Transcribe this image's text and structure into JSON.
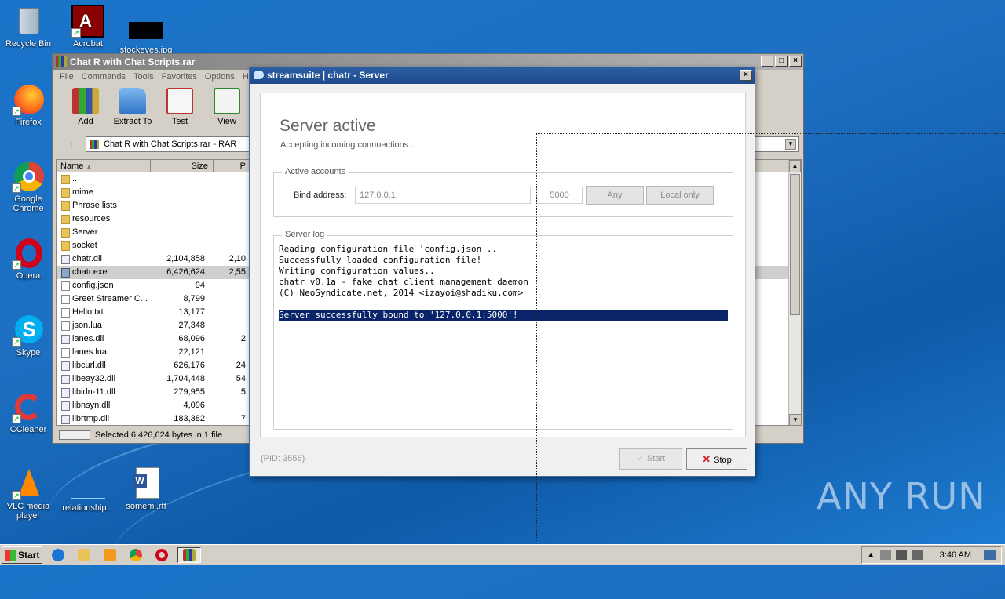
{
  "desktop": {
    "icons": [
      {
        "label": "Recycle Bin"
      },
      {
        "label": "Acrobat"
      },
      {
        "label": "stockeyes.jpg"
      },
      {
        "label": "Firefox"
      },
      {
        "label": "Google Chrome"
      },
      {
        "label": "Opera"
      },
      {
        "label": "Skype"
      },
      {
        "label": "CCleaner"
      },
      {
        "label": "VLC media player"
      },
      {
        "label": "relationship..."
      },
      {
        "label": "somemi.rtf"
      }
    ],
    "watermark": "ANY RUN"
  },
  "winrar": {
    "title": "Chat R with Chat Scripts.rar",
    "menu": [
      "File",
      "Commands",
      "Tools",
      "Favorites",
      "Options",
      "H"
    ],
    "toolbar": [
      {
        "label": "Add"
      },
      {
        "label": "Extract To"
      },
      {
        "label": "Test"
      },
      {
        "label": "View"
      }
    ],
    "address": "Chat R with Chat Scripts.rar - RAR",
    "columns": {
      "name": "Name",
      "size": "Size",
      "packed": "P"
    },
    "files": [
      {
        "name": "..",
        "size": "",
        "packed": "",
        "type": "folder"
      },
      {
        "name": "mime",
        "size": "",
        "packed": "",
        "type": "folder"
      },
      {
        "name": "Phrase lists",
        "size": "",
        "packed": "",
        "type": "folder"
      },
      {
        "name": "resources",
        "size": "",
        "packed": "",
        "type": "folder"
      },
      {
        "name": "Server",
        "size": "",
        "packed": "",
        "type": "folder"
      },
      {
        "name": "socket",
        "size": "",
        "packed": "",
        "type": "folder"
      },
      {
        "name": "chatr.dll",
        "size": "2,104,858",
        "packed": "2,10",
        "type": "dll"
      },
      {
        "name": "chatr.exe",
        "size": "6,426,624",
        "packed": "2,55",
        "type": "exe",
        "selected": true
      },
      {
        "name": "config.json",
        "size": "94",
        "packed": "",
        "type": "file"
      },
      {
        "name": "Greet Streamer C...",
        "size": "8,799",
        "packed": "",
        "type": "file"
      },
      {
        "name": "Hello.txt",
        "size": "13,177",
        "packed": "",
        "type": "file"
      },
      {
        "name": "json.lua",
        "size": "27,348",
        "packed": "",
        "type": "file"
      },
      {
        "name": "lanes.dll",
        "size": "68,096",
        "packed": "2",
        "type": "dll"
      },
      {
        "name": "lanes.lua",
        "size": "22,121",
        "packed": "",
        "type": "file"
      },
      {
        "name": "libcurl.dll",
        "size": "626,176",
        "packed": "24",
        "type": "dll"
      },
      {
        "name": "libeay32.dll",
        "size": "1,704,448",
        "packed": "54",
        "type": "dll"
      },
      {
        "name": "libidn-11.dll",
        "size": "279,955",
        "packed": "5",
        "type": "dll"
      },
      {
        "name": "libnsyn.dll",
        "size": "4,096",
        "packed": "",
        "type": "dll"
      },
      {
        "name": "librtmp.dll",
        "size": "183,382",
        "packed": "7",
        "type": "dll"
      }
    ],
    "status": "Selected 6,426,624 bytes in 1 file"
  },
  "dialog": {
    "title": "streamsuite | chatr - Server",
    "heading": "Server active",
    "subheading": "Accepting incoming connnections..",
    "accounts_legend": "Active accounts",
    "bind_label": "Bind address:",
    "bind_address": "127.0.0.1",
    "port": "5000",
    "any_button": "Any",
    "local_button": "Local only",
    "log_legend": "Server log",
    "log_lines": [
      "Reading configuration file 'config.json'..",
      "Successfully loaded configuration file!",
      "Writing configuration values..",
      "chatr v0.1a - fake chat client management daemon",
      "(C) NeoSyndicate.net, 2014 <izayoi@shadiku.com>",
      "",
      "Server successfully bound to '127.0.0.1:5000'!"
    ],
    "highlighted_line": 6,
    "pid": "(PID: 3556)",
    "start_button": "Start",
    "stop_button": "Stop"
  },
  "taskbar": {
    "start": "Start",
    "clock": "3:46 AM"
  },
  "colors": {
    "desktop": "#1d6fc2",
    "dialog_title": "#1e4b8a",
    "log_highlight": "#0a246a",
    "stop_icon": "#d52020"
  }
}
